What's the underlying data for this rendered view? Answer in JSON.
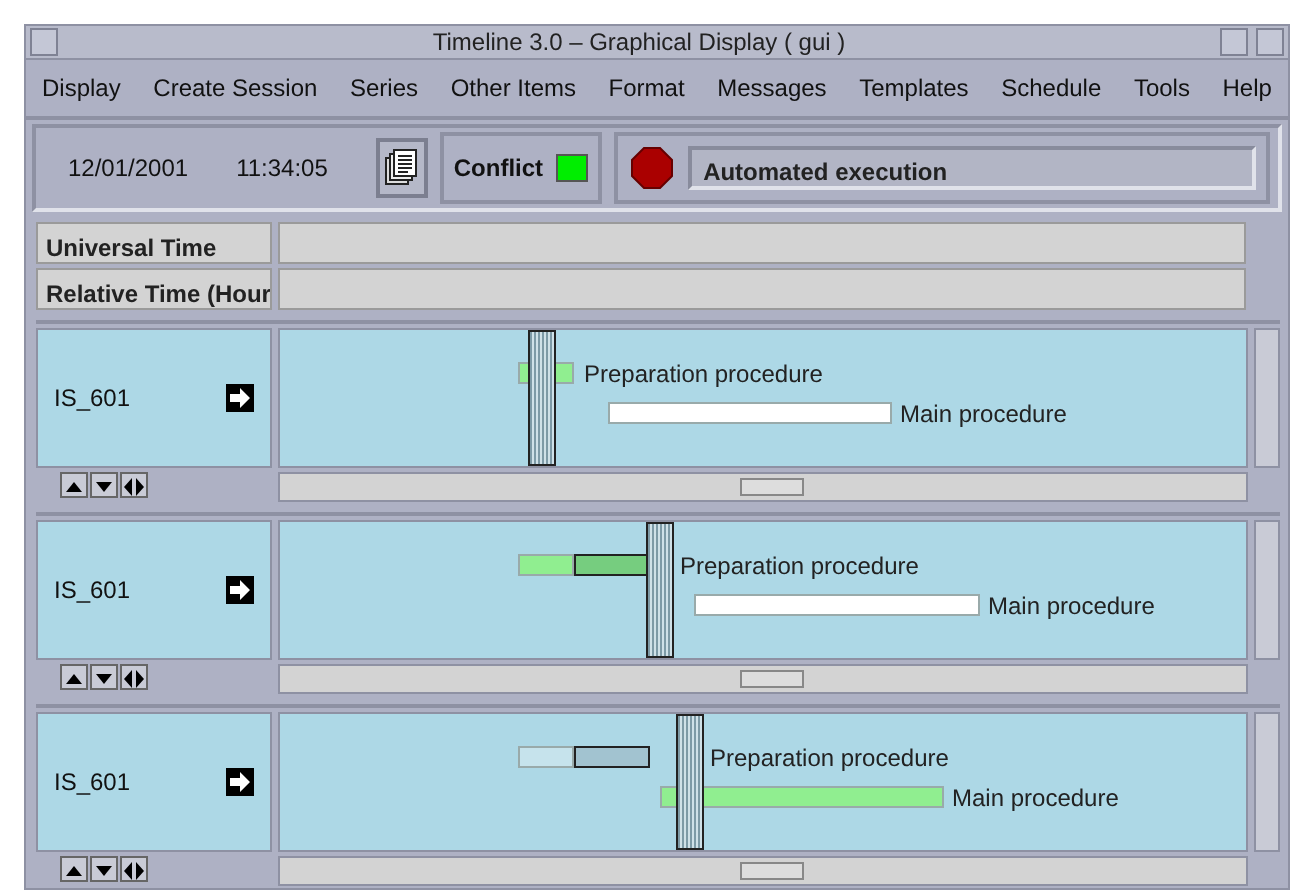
{
  "window": {
    "title": "Timeline 3.0 – Graphical Display ( gui )"
  },
  "menu": [
    "Display",
    "Create Session",
    "Series",
    "Other Items",
    "Format",
    "Messages",
    "Templates",
    "Schedule",
    "Tools",
    "Help"
  ],
  "toolbar": {
    "date": "12/01/2001",
    "time": "11:34:05",
    "conflict": {
      "label": "Conflict",
      "lit": true
    },
    "message": "Automated execution"
  },
  "headers": [
    "Universal Time",
    "Relative Time (Hour"
  ],
  "panels": [
    {
      "label": "IS_601",
      "tasks": [
        {
          "label": "Preparation procedure",
          "color": "#90ee90",
          "overrun": false
        },
        {
          "label": "Main procedure",
          "color": "#ffffff",
          "overrun": false
        }
      ]
    },
    {
      "label": "IS_601",
      "tasks": [
        {
          "label": "Preparation procedure",
          "color": "#90ee90",
          "overrun": true
        },
        {
          "label": "Main procedure",
          "color": "#ffffff",
          "overrun": false
        }
      ]
    },
    {
      "label": "IS_601",
      "tasks": [
        {
          "label": "Preparation procedure",
          "color": "#c6e3ec",
          "overrun": true
        },
        {
          "label": "Main procedure",
          "color": "#90ee90",
          "overrun": false
        }
      ]
    }
  ]
}
